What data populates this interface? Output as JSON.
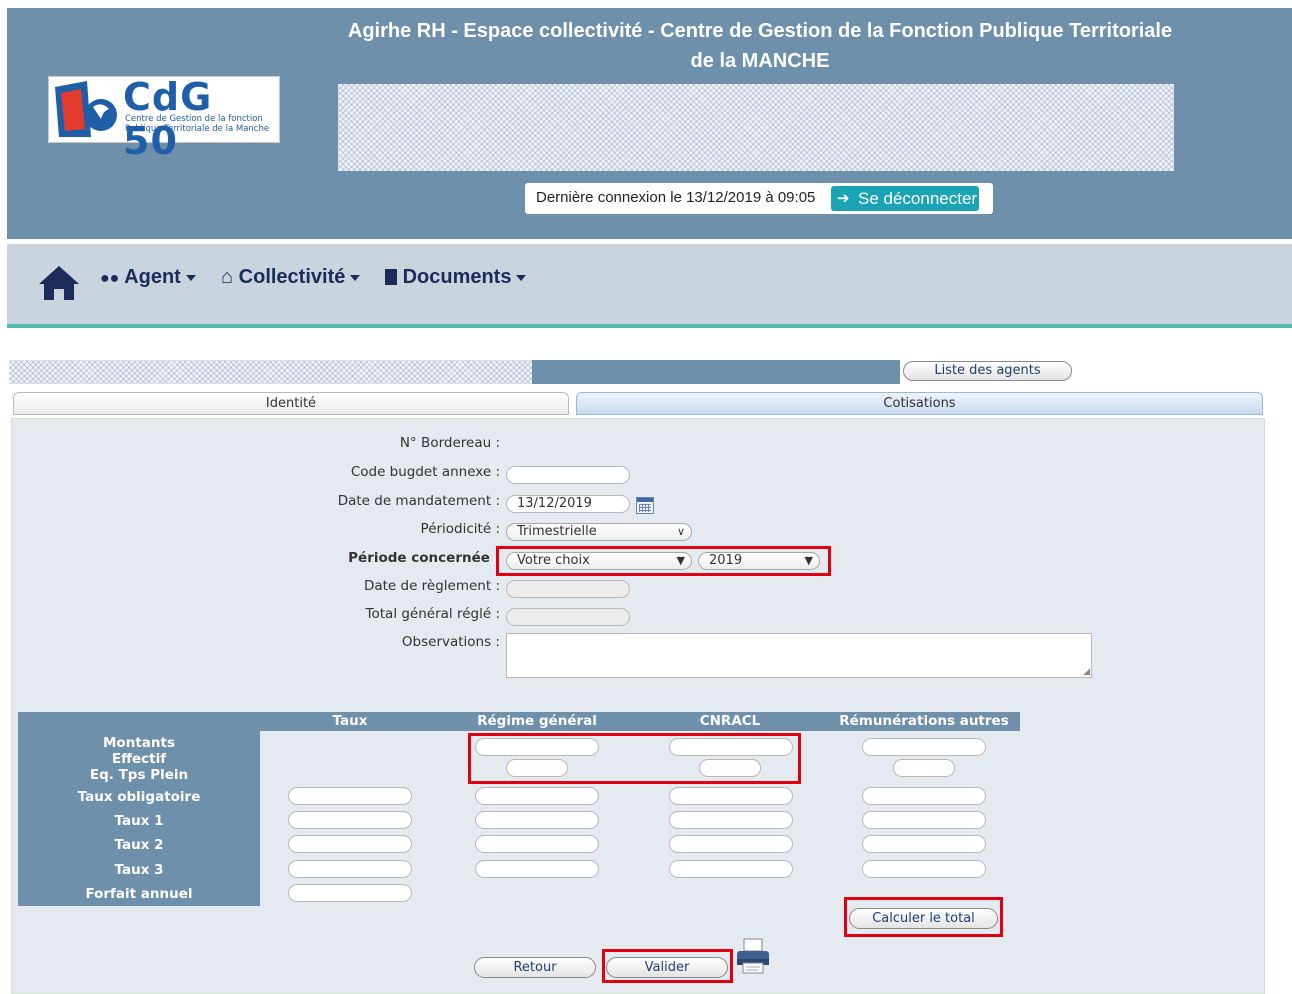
{
  "header": {
    "title": "Agirhe RH - Espace collectivité - Centre de Gestion de la Fonction Publique Territoriale de la MANCHE",
    "logo": {
      "brand": "CdG 50",
      "subtitle": "Centre de Gestion de la fonction Publique Territoriale de la Manche"
    },
    "last_connection": "Dernière connexion le 13/12/2019 à 09:05",
    "logout_label": "Se déconnecter"
  },
  "nav": {
    "items": [
      {
        "label": "Agent",
        "icon": "users-icon"
      },
      {
        "label": "Collectivité",
        "icon": "institution-icon"
      },
      {
        "label": "Documents",
        "icon": "document-icon"
      }
    ],
    "home_icon": "home-icon"
  },
  "agents_list_button": "Liste des agents",
  "tabs": [
    {
      "label": "Identité"
    },
    {
      "label": "Cotisations"
    }
  ],
  "form": {
    "bordereau_label": "N° Bordereau :",
    "code_budget_label": "Code bugdet annexe :",
    "date_mandatement_label": "Date de mandatement :",
    "date_mandatement_value": "13/12/2019",
    "periodicite_label": "Périodicité :",
    "periodicite_value": "Trimestrielle",
    "periode_label": "Période concernée :",
    "periode_choice": "Votre choix",
    "periode_year": "2019",
    "date_reglement_label": "Date de règlement :",
    "total_regle_label": "Total général réglé :",
    "observations_label": "Observations :"
  },
  "grid": {
    "columns": [
      "Taux",
      "Régime général",
      "CNRACL",
      "Rémunérations autres"
    ],
    "rows": {
      "montants": "Montants",
      "effectif": "Effectif",
      "eq_tps_plein": "Eq. Tps Plein",
      "taux_obligatoire": "Taux obligatoire",
      "taux1": "Taux 1",
      "taux2": "Taux 2",
      "taux3": "Taux 3",
      "forfait_annuel": "Forfait annuel"
    }
  },
  "buttons": {
    "calculer": "Calculer le total",
    "retour": "Retour",
    "valider": "Valider"
  },
  "colors": {
    "header_bg": "#6f90aa",
    "nav_bg": "#c9d4df",
    "accent": "#1aa3b5",
    "highlight": "#e0000f"
  }
}
